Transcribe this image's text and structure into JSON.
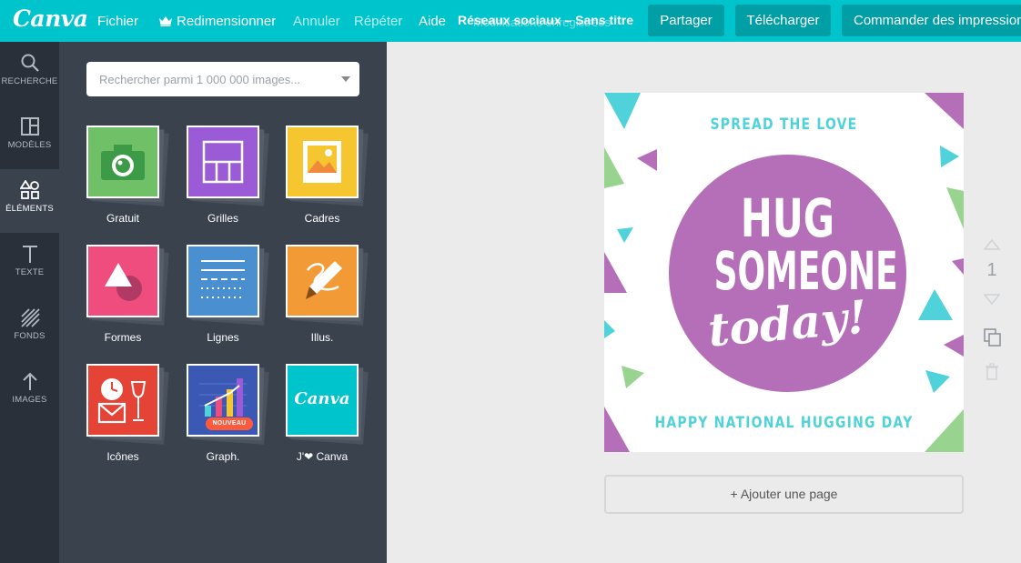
{
  "app": {
    "logo": "Canva"
  },
  "menu": {
    "file": "Fichier",
    "resize": "Redimensionner",
    "undo": "Annuler",
    "redo": "Répéter",
    "help": "Aide"
  },
  "document": {
    "title": "Réseaux sociaux – Sans titre",
    "status": "Modifications enregistrées"
  },
  "actions": {
    "share": "Partager",
    "download": "Télécharger",
    "order_prints": "Commander des impressions"
  },
  "rail": [
    {
      "label": "RECHERCHE",
      "icon": "search-icon"
    },
    {
      "label": "MODÈLES",
      "icon": "layout-icon"
    },
    {
      "label": "ÉLÉMENTS",
      "icon": "shapes-icon",
      "active": true
    },
    {
      "label": "TEXTE",
      "icon": "text-icon"
    },
    {
      "label": "FONDS",
      "icon": "hatch-icon"
    },
    {
      "label": "IMAGES",
      "icon": "upload-arrow-icon"
    }
  ],
  "search": {
    "placeholder": "Rechercher parmi 1 000 000 images..."
  },
  "elements": [
    {
      "label": "Gratuit",
      "icon": "camera-icon",
      "color": "#6fc067"
    },
    {
      "label": "Grilles",
      "icon": "grid-icon",
      "color": "#9b5bd6"
    },
    {
      "label": "Cadres",
      "icon": "frame-icon",
      "color": "#f6c630"
    },
    {
      "label": "Formes",
      "icon": "shapes-icon",
      "color": "#ee4d7d"
    },
    {
      "label": "Lignes",
      "icon": "lines-icon",
      "color": "#4a90d0"
    },
    {
      "label": "Illus.",
      "icon": "pencil-icon",
      "color": "#f29b36"
    },
    {
      "label": "Icônes",
      "icon": "clock-wine-icon",
      "color": "#e44336"
    },
    {
      "label": "Graph.",
      "icon": "bar-chart-icon",
      "color": "#3a58b4",
      "badge": "NOUVEAU"
    },
    {
      "label": "J'❤ Canva",
      "icon": "canva-logo-icon",
      "color": "#00c4cc",
      "logo": "Canva"
    }
  ],
  "design": {
    "top_text": "SPREAD THE LOVE",
    "line1": "HUG",
    "line2": "SOMEONE",
    "line3": "today!",
    "bottom_text": "HAPPY NATIONAL HUGGING DAY",
    "colors": {
      "purple": "#b56fb8",
      "teal": "#4fd2d9",
      "green": "#98d48f"
    }
  },
  "page_controls": {
    "page_number": "1"
  },
  "add_page": "+ Ajouter une page"
}
